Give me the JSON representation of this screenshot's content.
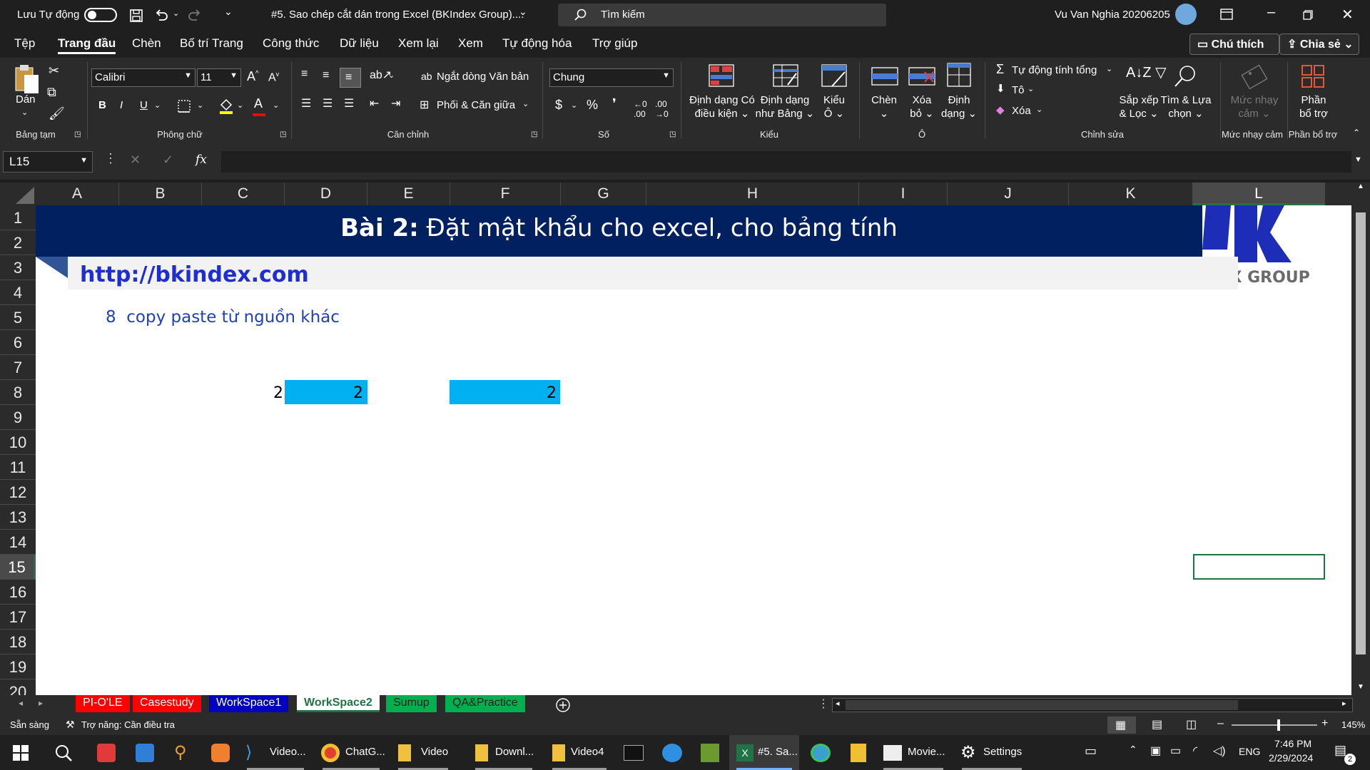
{
  "titlebar": {
    "autosave_label": "Lưu Tự động",
    "doc_title": "#5. Sao chép cắt dán trong Excel (BKIndex Group)....",
    "search_placeholder": "Tìm kiếm",
    "user_name": "Vu Van Nghia 20206205"
  },
  "tabs": [
    "Tệp",
    "Trang đầu",
    "Chèn",
    "Bố trí Trang",
    "Công thức",
    "Dữ liệu",
    "Xem lại",
    "Xem",
    "Tự động hóa",
    "Trợ giúp"
  ],
  "active_tab": "Trang đầu",
  "actions": {
    "comments": "Chú thích",
    "share": "Chia sẻ"
  },
  "ribbon": {
    "clipboard": {
      "paste": "Dán",
      "group": "Bảng tạm"
    },
    "font": {
      "name": "Calibri",
      "size": "11",
      "group": "Phông chữ"
    },
    "alignment": {
      "wrap": "Ngắt dòng Văn bản",
      "merge": "Phối & Căn giữa",
      "group": "Căn chỉnh"
    },
    "number": {
      "format": "Chung",
      "group": "Số"
    },
    "styles": {
      "cond_line1": "Định dạng Có",
      "cond_line2": "điều kiện",
      "table_line1": "Định dạng",
      "table_line2": "như Bảng",
      "cell_line1": "Kiểu",
      "cell_line2": "Ô",
      "group": "Kiểu"
    },
    "cells": {
      "insert": "Chèn",
      "delete_line1": "Xóa",
      "delete_line2": "bỏ",
      "format_line1": "Định",
      "format_line2": "dạng",
      "group": "Ô"
    },
    "editing": {
      "autosum": "Tự động tính tổng",
      "fill": "Tô",
      "clear": "Xóa",
      "sort_line1": "Sắp xếp",
      "sort_line2": "& Lọc",
      "find_line1": "Tìm & Lựa",
      "find_line2": "chọn",
      "group": "Chỉnh sửa"
    },
    "sensitivity": {
      "line1": "Mức nhạy",
      "line2": "cảm",
      "group": "Mức nhạy cảm"
    },
    "addins": {
      "line1": "Phần",
      "line2": "bổ trợ",
      "group": "Phần bổ trợ"
    }
  },
  "formula_bar": {
    "name_box": "L15",
    "fx": "fx",
    "value": ""
  },
  "columns": [
    "A",
    "B",
    "C",
    "D",
    "E",
    "F",
    "G",
    "H",
    "I",
    "J",
    "K",
    "L"
  ],
  "selected_column": "L",
  "rows": [
    "1",
    "2",
    "3",
    "4",
    "5",
    "6",
    "7",
    "8",
    "9",
    "10",
    "11",
    "12",
    "13",
    "14",
    "15",
    "16",
    "17",
    "18",
    "19",
    "20"
  ],
  "selected_row": "15",
  "sheet": {
    "banner_bold": "Bài 2:",
    "banner_rest": " Đặt mật khẩu cho excel, cho bảng tính",
    "url": "http://bkindex.com",
    "note_num": "8",
    "note_text": "copy paste từ nguồn khác",
    "c8": "2",
    "d8": "2",
    "f8": "2",
    "logo_text": "IDEX GROUP"
  },
  "sheet_tabs": [
    {
      "label": "PI-O'LE",
      "color": "#ff0000"
    },
    {
      "label": "Casestudy",
      "color": "#ff0000"
    },
    {
      "label": "WorkSpace1",
      "color": "#0000c0"
    },
    {
      "label": "WorkSpace2",
      "color": "#ffffff"
    },
    {
      "label": "Sumup",
      "color": "#00b050"
    },
    {
      "label": "QA&Practice",
      "color": "#00b050"
    }
  ],
  "active_sheet": "WorkSpace2",
  "status": {
    "ready": "Sẵn sàng",
    "accessibility": "Trợ năng: Cần điều tra",
    "zoom": "145%"
  },
  "taskbar": {
    "items": [
      "Video...",
      "ChatG...",
      "Video",
      "Downl...",
      "Video4",
      "#5. Sa...",
      "Movie...",
      "Settings"
    ],
    "lang": "ENG",
    "time": "7:46 PM",
    "date": "2/29/2024",
    "notif_count": "2"
  }
}
